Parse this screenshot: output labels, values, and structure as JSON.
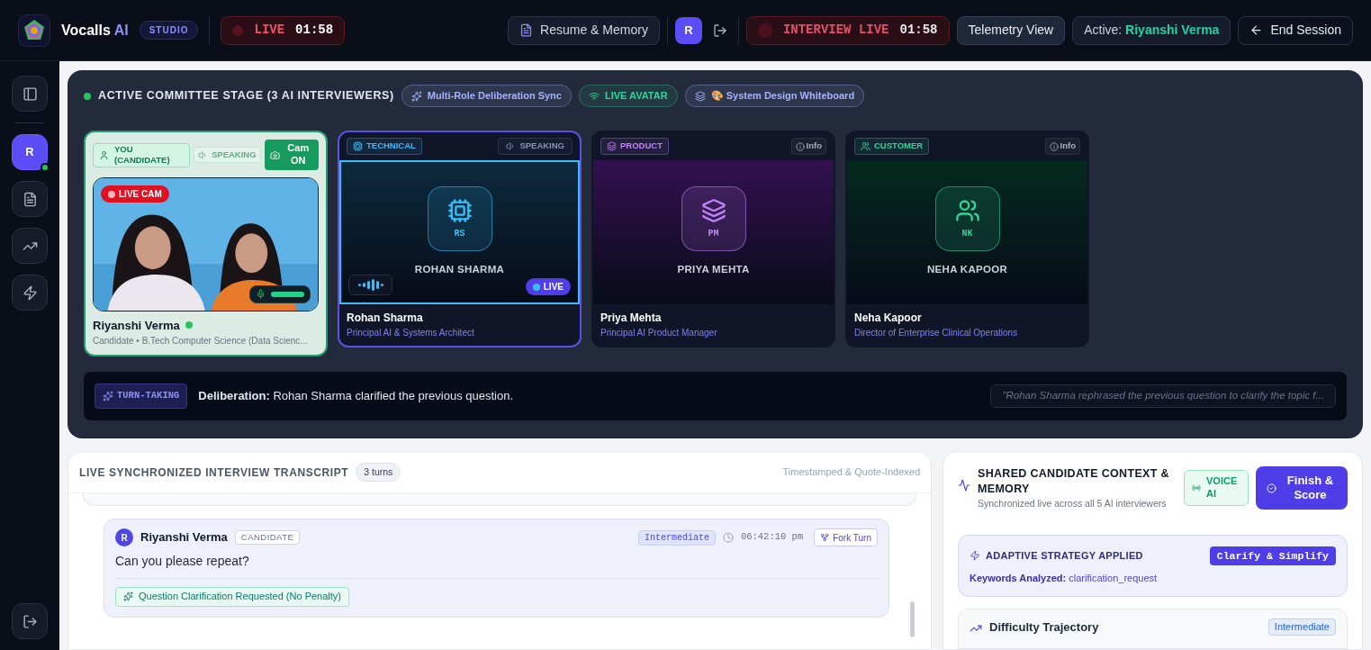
{
  "header": {
    "brand": "Vocalls",
    "brand_accent": "AI",
    "edition": "STUDIO",
    "live": {
      "label": "LIVE",
      "time": "01:58"
    },
    "resume_button": "Resume & Memory",
    "avatar": "R",
    "interview_live": {
      "label": "INTERVIEW LIVE",
      "time": "01:58"
    },
    "telemetry_button": "Telemetry View",
    "active": {
      "label": "Active:",
      "name": "Riyanshi Verma"
    },
    "end_button": "End Session"
  },
  "sidebar": {
    "items": [
      {
        "kind": "panel",
        "selected": false
      },
      {
        "kind": "avatar",
        "label": "R",
        "selected": true,
        "online": true
      },
      {
        "kind": "file",
        "selected": false
      },
      {
        "kind": "trend",
        "selected": false
      },
      {
        "kind": "zap",
        "selected": false
      }
    ],
    "bottom": {
      "kind": "logout"
    }
  },
  "stage": {
    "title": "ACTIVE COMMITTEE STAGE (3 AI INTERVIEWERS)",
    "live": true,
    "tags": [
      {
        "kind": "sparkles",
        "label": "Multi-Role Deliberation Sync",
        "color": "#a5b4fc"
      },
      {
        "kind": "wifi",
        "label": "LIVE AVATAR",
        "color": "#34d399"
      },
      {
        "kind": "layers",
        "label": "🎨 System Design Whiteboard",
        "color": "#a5b4fc"
      }
    ],
    "candidate": {
      "badge": "YOU (CANDIDATE)",
      "speaking_label": "SPEAKING",
      "speaking": false,
      "cam_button": "Cam ON",
      "cam_on": true,
      "cam_badge": "LIVE CAM",
      "mic": {
        "level": 1
      },
      "name": "Riyanshi Verma",
      "online": true,
      "subtitle": "Candidate • B.Tech Computer Science (Data Scienc..."
    },
    "interviewers": [
      {
        "kind": "cpu",
        "role": "TECHNICAL",
        "color": "#38bdf8",
        "chip": {
          "kind": "speaking",
          "label": "SPEAKING"
        },
        "initials": "RS",
        "display_name": "ROHAN SHARMA",
        "name": "Rohan Sharma",
        "title": "Principal AI & Systems Architect",
        "selected": true,
        "live_badge": "LIVE"
      },
      {
        "kind": "layers",
        "role": "PRODUCT",
        "color": "#c084fc",
        "chip": {
          "kind": "info",
          "label": "Info"
        },
        "initials": "PM",
        "display_name": "PRIYA MEHTA",
        "name": "Priya Mehta",
        "title": "Principal AI Product Manager",
        "selected": false
      },
      {
        "kind": "users",
        "role": "CUSTOMER",
        "color": "#34d399",
        "chip": {
          "kind": "info",
          "label": "Info"
        },
        "initials": "NK",
        "display_name": "NEHA KAPOOR",
        "name": "Neha Kapoor",
        "title": "Director of Enterprise Clinical Operations",
        "selected": false
      }
    ],
    "turn": {
      "badge": "TURN-TAKING",
      "text": "**Deliberation:** Rohan Sharma clarified the previous question.",
      "quote": "\"Rohan Sharma rephrased the previous question to clarify the topic f..."
    }
  },
  "transcript": {
    "title": "LIVE SYNCHRONIZED INTERVIEW TRANSCRIPT",
    "count": "3 turns",
    "note": "Timestamped & Quote-Indexed",
    "message": {
      "avatar": "R",
      "name": "Riyanshi Verma",
      "role": "CANDIDATE",
      "level": "Intermediate",
      "time": "06:42:10 pm",
      "fork_button": "Fork Turn",
      "text": "Can you please repeat?",
      "tag": "Question Clarification Requested (No Penalty)"
    }
  },
  "context": {
    "title": "SHARED CANDIDATE CONTEXT & MEMORY",
    "subtitle": "Synchronized live across all 5 AI interviewers",
    "voice_badge": "VOICE AI",
    "finish_button": "Finish & Score",
    "strategy": {
      "title": "ADAPTIVE STRATEGY APPLIED",
      "badge": "Clarify & Simplify",
      "keywords_label": "Keywords Analyzed:",
      "keywords": "clarification_request"
    },
    "difficulty": {
      "title": "Difficulty Trajectory",
      "badge": "Intermediate"
    }
  }
}
